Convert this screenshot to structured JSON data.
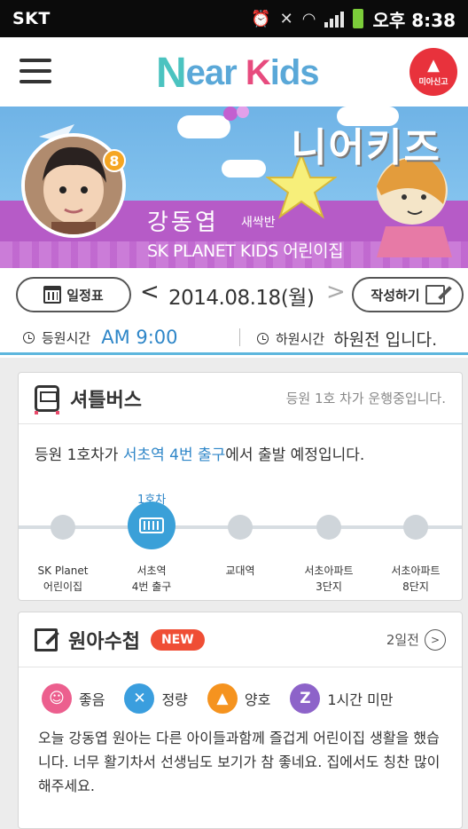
{
  "statusbar": {
    "carrier": "SKT",
    "time": "오후 8:38"
  },
  "header": {
    "logo": {
      "n": "N",
      "ear": "ear",
      "k": "K",
      "ids": "ids"
    },
    "alarm_label": "미아신고"
  },
  "banner": {
    "title": "니어키즈",
    "child_name": "강동엽",
    "child_class": "새싹반",
    "school": "SK PLANET KIDS 어린이집",
    "badge_count": "8"
  },
  "date_nav": {
    "schedule_label": "일정표",
    "date": "2014.08.18(월)",
    "prev": "<",
    "next": ">",
    "write_label": "작성하기"
  },
  "times": {
    "arrival_label": "등원시간",
    "arrival_value": "AM 9:00",
    "departure_label": "하원시간",
    "departure_value": "하원전 입니다."
  },
  "shuttle": {
    "title": "셔틀버스",
    "status": "등원 1호 차가 운행중입니다.",
    "message_pre": "등원 1호차가 ",
    "message_highlight": "서초역 4번 출구",
    "message_post": "에서 출발 예정입니다.",
    "bus_tag": "1호차",
    "stops": [
      {
        "line1": "SK Planet",
        "line2": "어린이집"
      },
      {
        "line1": "서초역",
        "line2": "4번 출구"
      },
      {
        "line1": "교대역",
        "line2": ""
      },
      {
        "line1": "서초아파트",
        "line2": "3단지"
      },
      {
        "line1": "서초아파트",
        "line2": "8단지"
      }
    ]
  },
  "diary": {
    "title": "원아수첩",
    "new_badge": "NEW",
    "more_label": "2일전",
    "statuses": [
      {
        "label": "좋음",
        "color": "#ec5f8e",
        "glyph": "☺"
      },
      {
        "label": "정량",
        "color": "#3a9ede",
        "glyph": "✕"
      },
      {
        "label": "양호",
        "color": "#f5931f",
        "glyph": "▲"
      },
      {
        "label": "1시간 미만",
        "color": "#8d63c9",
        "glyph": "Z"
      }
    ],
    "text": "오늘 강동엽 원아는 다른 아이들과함께 즐겁게 어린이집 생활을 했습니다. 너무 활기차서 선생님도 보기가 참 좋네요. 집에서도 칭찬 많이 해주세요."
  }
}
